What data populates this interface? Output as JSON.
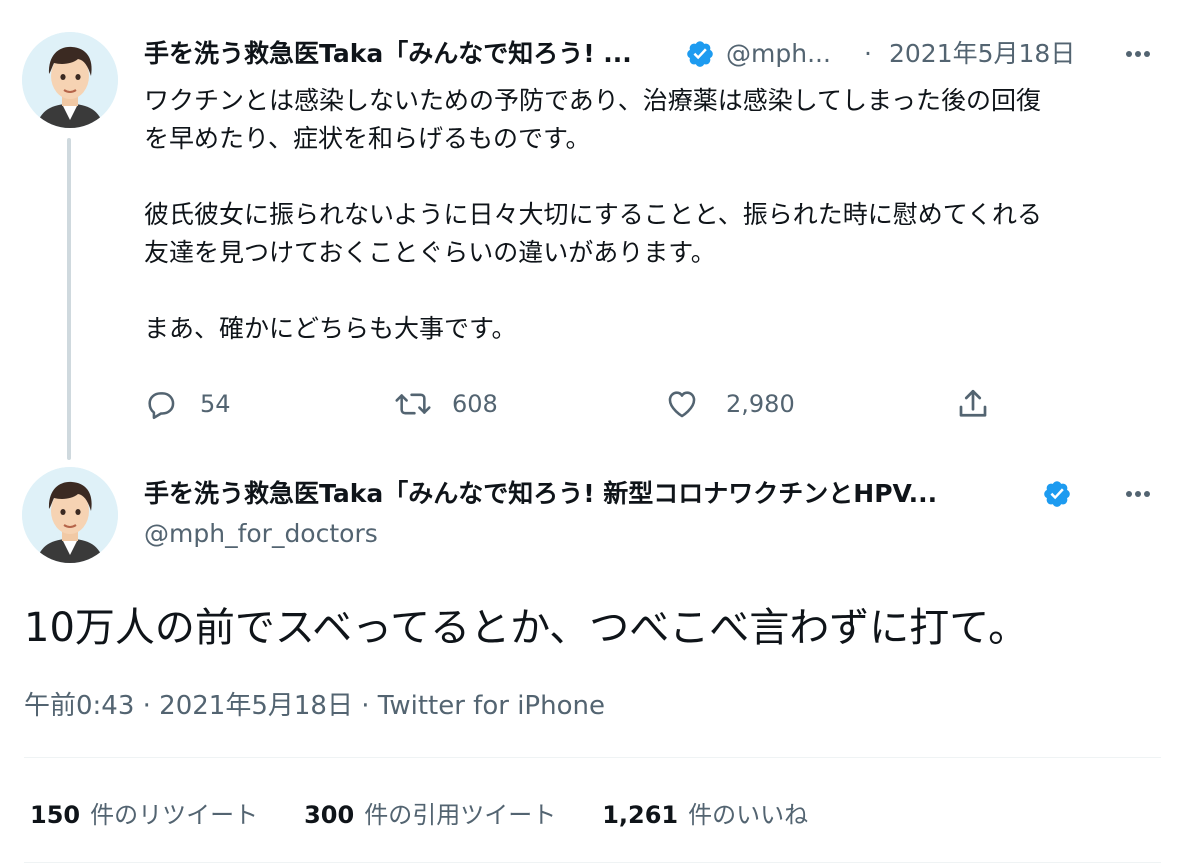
{
  "colors": {
    "verified_blue": "#1d9bf0",
    "secondary_text": "#536471",
    "primary_text": "#0f1419",
    "thread_line": "#cfd9de"
  },
  "tweet1": {
    "name": "手を洗う救急医Taka「みんなで知ろう! ...",
    "handle": "@mph...",
    "separator": "·",
    "date": "2021年5月18日",
    "body": "ワクチンとは感染しないための予防であり、治療薬は感染してしまった後の回復\nを早めたり、症状を和らげるものです。\n\n彼氏彼女に振られないように日々大切にすることと、振られた時に慰めてくれる\n友達を見つけておくことぐらいの違いがあります。\n\nまあ、確かにどちらも大事です。",
    "actions": {
      "reply_icon": "reply-icon",
      "reply_count": "54",
      "retweet_icon": "retweet-icon",
      "retweet_count": "608",
      "like_icon": "heart-icon",
      "like_count": "2,980",
      "share_icon": "share-icon"
    }
  },
  "tweet2": {
    "name": "手を洗う救急医Taka「みんなで知ろう! 新型コロナワクチンとHPV...",
    "handle": "@mph_for_doctors",
    "text": "10万人の前でスベってるとか、つべこべ言わずに打て。",
    "meta": "午前0:43 · 2021年5月18日 · Twitter for iPhone",
    "stats": {
      "retweets_num": "150",
      "retweets_label": "件のリツイート",
      "quotes_num": "300",
      "quotes_label": "件の引用ツイート",
      "likes_num": "1,261",
      "likes_label": "件のいいね"
    }
  }
}
